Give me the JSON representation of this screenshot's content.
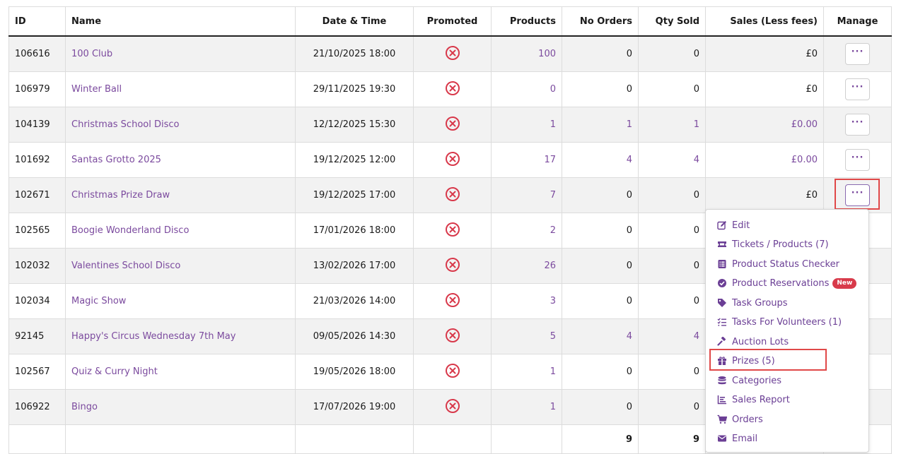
{
  "columns": {
    "id": "ID",
    "name": "Name",
    "datetime": "Date & Time",
    "promoted": "Promoted",
    "products": "Products",
    "no_orders": "No Orders",
    "qty_sold": "Qty Sold",
    "sales": "Sales (Less fees)",
    "manage": "Manage"
  },
  "rows": [
    {
      "id": "106616",
      "name": "100 Club",
      "datetime": "21/10/2025 18:00",
      "products": "100",
      "no_orders": "0",
      "qty_sold": "0",
      "sales": "£0"
    },
    {
      "id": "106979",
      "name": "Winter Ball",
      "datetime": "29/11/2025 19:30",
      "products": "0",
      "no_orders": "0",
      "qty_sold": "0",
      "sales": "£0"
    },
    {
      "id": "104139",
      "name": "Christmas School Disco",
      "datetime": "12/12/2025 15:30",
      "products": "1",
      "no_orders": "1",
      "qty_sold": "1",
      "sales": "£0.00"
    },
    {
      "id": "101692",
      "name": "Santas Grotto 2025",
      "datetime": "19/12/2025 12:00",
      "products": "17",
      "no_orders": "4",
      "qty_sold": "4",
      "sales": "£0.00"
    },
    {
      "id": "102671",
      "name": "Christmas Prize Draw",
      "datetime": "19/12/2025 17:00",
      "products": "7",
      "no_orders": "0",
      "qty_sold": "0",
      "sales": "£0"
    },
    {
      "id": "102565",
      "name": "Boogie Wonderland Disco",
      "datetime": "17/01/2026 18:00",
      "products": "2",
      "no_orders": "0",
      "qty_sold": "0",
      "sales": ""
    },
    {
      "id": "102032",
      "name": "Valentines School Disco",
      "datetime": "13/02/2026 17:00",
      "products": "26",
      "no_orders": "0",
      "qty_sold": "0",
      "sales": ""
    },
    {
      "id": "102034",
      "name": "Magic Show",
      "datetime": "21/03/2026 14:00",
      "products": "3",
      "no_orders": "0",
      "qty_sold": "0",
      "sales": ""
    },
    {
      "id": "92145",
      "name": "Happy's Circus Wednesday 7th May",
      "datetime": "09/05/2026 14:30",
      "products": "5",
      "no_orders": "4",
      "qty_sold": "4",
      "sales": ""
    },
    {
      "id": "102567",
      "name": "Quiz & Curry Night",
      "datetime": "19/05/2026 18:00",
      "products": "1",
      "no_orders": "0",
      "qty_sold": "0",
      "sales": ""
    },
    {
      "id": "106922",
      "name": "Bingo",
      "datetime": "17/07/2026 19:00",
      "products": "1",
      "no_orders": "0",
      "qty_sold": "0",
      "sales": ""
    }
  ],
  "totals": {
    "no_orders": "9",
    "qty_sold": "9"
  },
  "manage_button_label": "···",
  "dropdown": {
    "items": [
      {
        "label": "Edit",
        "icon": "edit-icon"
      },
      {
        "label": "Tickets / Products (7)",
        "icon": "ticket-icon"
      },
      {
        "label": "Product Status Checker",
        "icon": "list-icon"
      },
      {
        "label": "Product Reservations",
        "icon": "check-circle-icon",
        "badge": "New"
      },
      {
        "label": "Task Groups",
        "icon": "tag-icon"
      },
      {
        "label": "Tasks For Volunteers (1)",
        "icon": "checklist-icon"
      },
      {
        "label": "Auction Lots",
        "icon": "gavel-icon"
      },
      {
        "label": "Prizes (5)",
        "icon": "gift-icon"
      },
      {
        "label": "Categories",
        "icon": "database-icon"
      },
      {
        "label": "Sales Report",
        "icon": "chart-icon"
      },
      {
        "label": "Orders",
        "icon": "cart-icon"
      },
      {
        "label": "Email",
        "icon": "envelope-icon"
      }
    ]
  },
  "colors": {
    "link": "#7b4a9e",
    "menu_text": "#6b3f95",
    "promoted_no": "#d8384a",
    "highlight": "#e04848",
    "badge": "#d83a4a"
  }
}
